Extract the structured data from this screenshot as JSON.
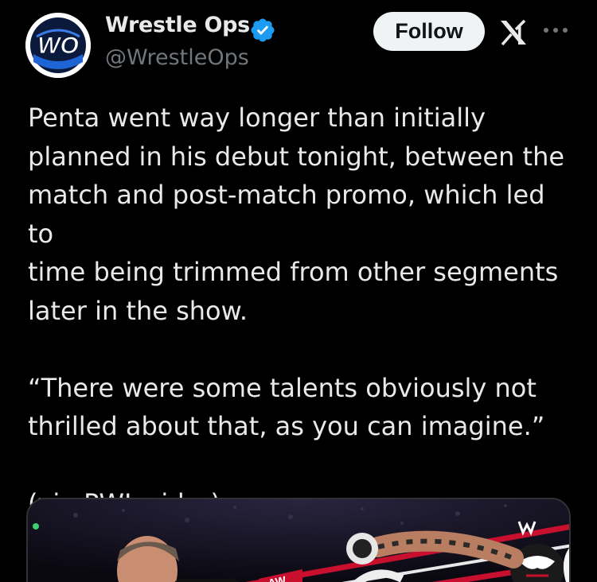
{
  "author": {
    "display_name": "Wrestle Ops",
    "handle": "@WrestleOps",
    "avatar_text": "WO",
    "verified": true
  },
  "actions": {
    "follow_label": "Follow"
  },
  "icons": {
    "verified": "verified-badge-icon",
    "logo": "x-logo-icon",
    "more": "more-options-icon"
  },
  "tweet": {
    "paragraphs": [
      "Penta went way longer than initially\nplanned in his debut tonight, between the\nmatch and post-match promo, which led to\ntime being trimmed from other segments\nlater in the show.",
      "“There were some talents obviously not\nthrilled about that, as you can imagine.”",
      "(via PWInsider)"
    ]
  },
  "media": {
    "overlay_text": "AW"
  },
  "colors": {
    "background": "#000000",
    "text_primary": "#e7e9ea",
    "text_secondary": "#71767b",
    "verified_blue": "#1d9bf0",
    "button_bg": "#eff3f4",
    "button_text": "#0f1419"
  }
}
